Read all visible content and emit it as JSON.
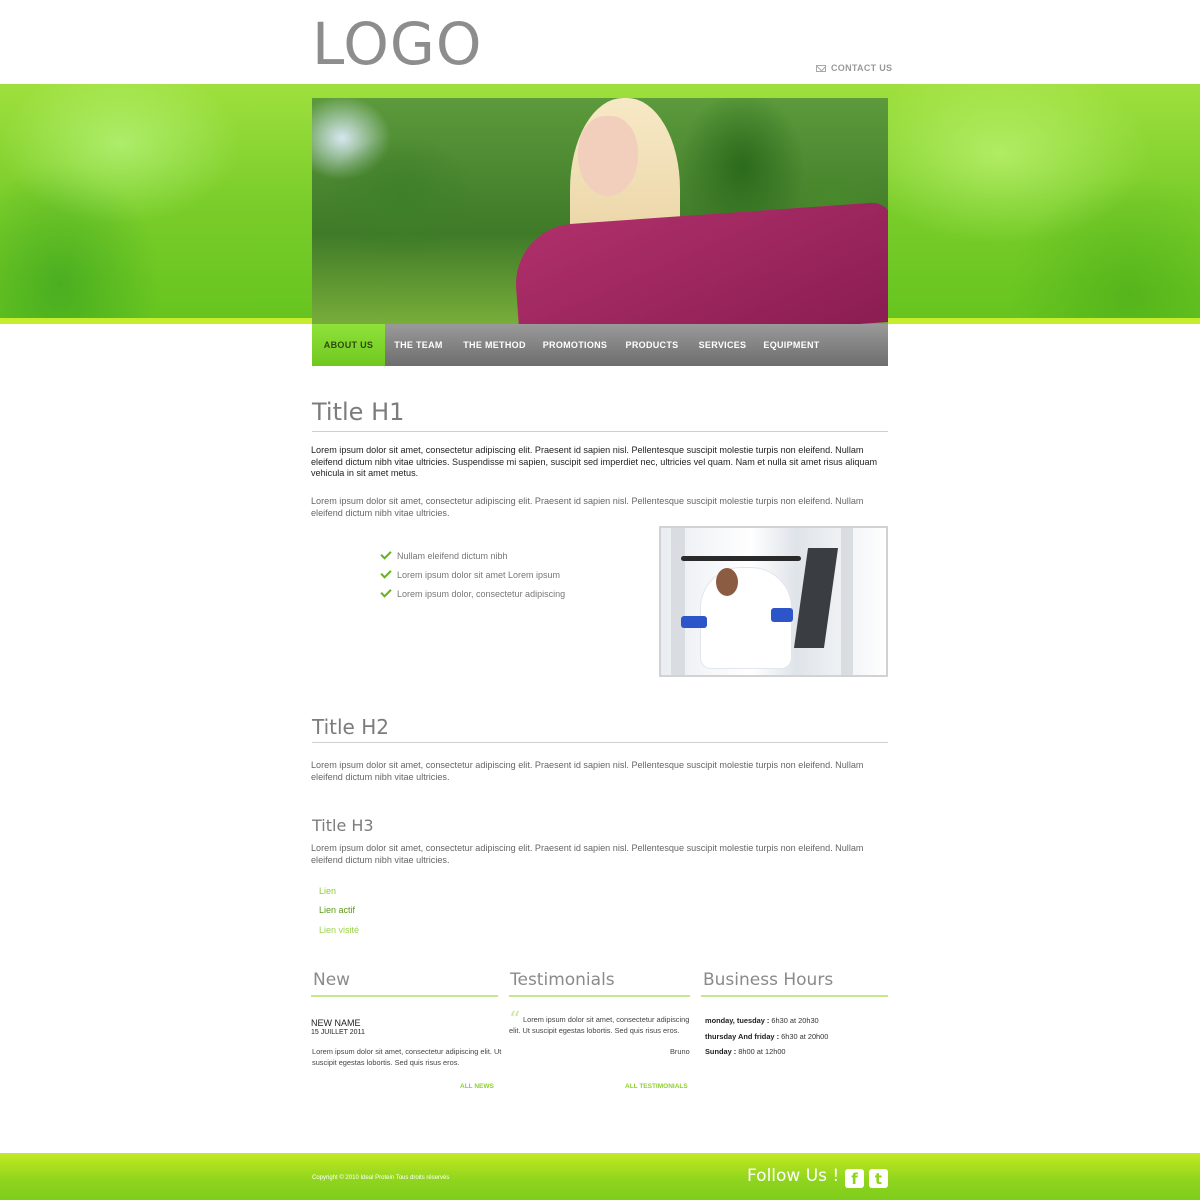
{
  "header": {
    "logo": "LOGO",
    "contact_label": "CONTACT US"
  },
  "nav": {
    "items": [
      {
        "label": "ABOUT US",
        "active": true
      },
      {
        "label": "THE TEAM"
      },
      {
        "label": "THE METHOD"
      },
      {
        "label": "PROMOTIONS"
      },
      {
        "label": "PRODUCTS"
      },
      {
        "label": "SERVICES"
      },
      {
        "label": "EQUIPMENT"
      }
    ]
  },
  "content": {
    "h1": "Title H1",
    "p1": "Lorem ipsum dolor sit amet, consectetur adipiscing elit. Praesent id sapien nisl. Pellentesque suscipit molestie turpis non eleifend. Nullam eleifend dictum nibh vitae ultricies. Suspendisse mi sapien, suscipit sed imperdiet nec, ultricies vel quam. Nam et nulla sit amet risus aliquam vehicula in sit amet metus.",
    "p2": "Lorem ipsum dolor sit amet, consectetur adipiscing elit. Praesent id sapien nisl. Pellentesque suscipit molestie turpis non eleifend. Nullam eleifend dictum nibh vitae ultricies.",
    "checklist": [
      "Nullam eleifend dictum nibh",
      "Lorem ipsum dolor sit amet Lorem ipsum",
      "Lorem ipsum dolor, consectetur adipiscing"
    ],
    "h2": "Title H2",
    "p3": "Lorem ipsum dolor sit amet, consectetur adipiscing elit. Praesent id sapien nisl. Pellentesque suscipit molestie turpis non eleifend. Nullam eleifend dictum nibh vitae ultricies.",
    "h3": "Title H3",
    "p4": "Lorem ipsum dolor sit amet, consectetur adipiscing elit. Praesent id sapien nisl. Pellentesque suscipit molestie turpis non eleifend. Nullam eleifend dictum nibh vitae ultricies.",
    "links": {
      "link": "Lien",
      "active": "Lien actif",
      "visited": "Lien visité"
    }
  },
  "columns": {
    "new": {
      "title": "New",
      "name": "NEW NAME",
      "date": "15 JUILLET 2011",
      "text": "Lorem ipsum dolor sit amet, consectetur adipiscing elit. Ut suscipit egestas lobortis. Sed quis risus eros.",
      "more": "ALL NEWS"
    },
    "testimonials": {
      "title": "Testimonials",
      "quote_mark": "“",
      "text": "Lorem ipsum dolor sit amet, consectetur adipiscing elit. Ut suscipit egestas lobortis. Sed quis risus eros.",
      "author": "Bruno",
      "more": "ALL TESTIMONIALS"
    },
    "hours": {
      "title": "Business Hours",
      "rows": [
        {
          "days": "monday, tuesday :",
          "time": " 6h30 at 20h30"
        },
        {
          "days": "thursday And friday :",
          "time": " 6h30 at 20h00"
        },
        {
          "days": "Sunday :",
          "time": " 8h00 at 12h00"
        }
      ]
    }
  },
  "footer": {
    "copyright": "Copyright © 2010 Ideal Protein Tous droits réservés",
    "follow": "Follow Us !",
    "facebook_glyph": "f",
    "twitter_glyph": "t"
  },
  "colors": {
    "accent": "#8cd12c",
    "nav_gray": "#7a7a7a",
    "band_green": "#7acd2a"
  }
}
